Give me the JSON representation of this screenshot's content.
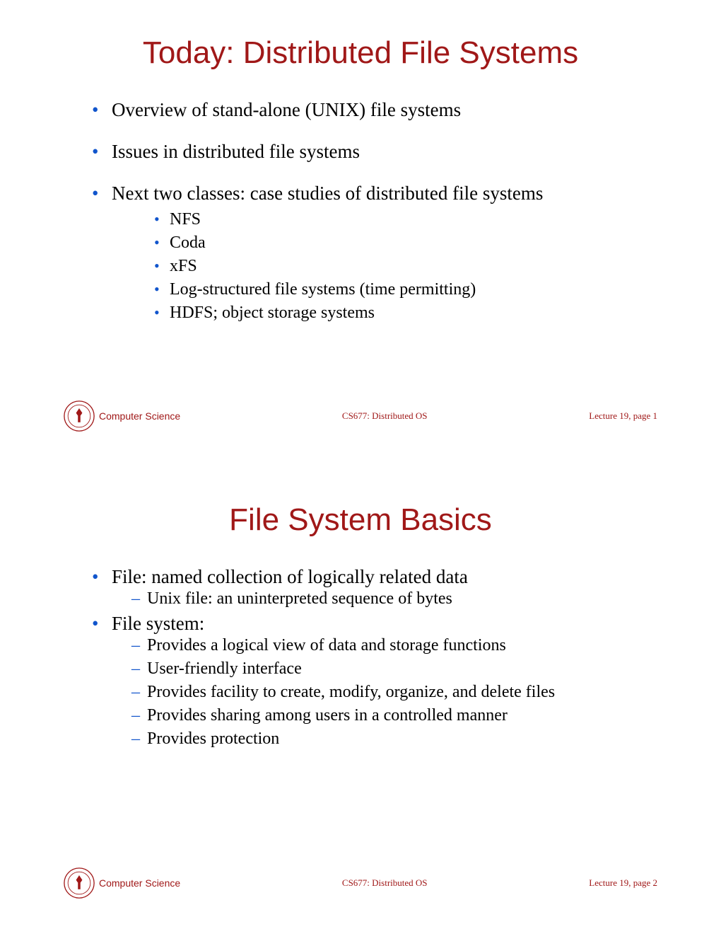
{
  "footer": {
    "dept": "Computer Science",
    "course": "CS677: Distributed OS",
    "lecture_prefix": "Lecture 19, page "
  },
  "slide1": {
    "title": "Today: Distributed File Systems",
    "page": "1",
    "b1": "Overview of stand-alone (UNIX) file systems",
    "b2": "Issues in distributed file systems",
    "b3": "Next two classes: case studies of distributed file systems",
    "sub": {
      "s1": "NFS",
      "s2": "Coda",
      "s3": "xFS",
      "s4": "Log-structured file systems (time permitting)",
      "s5": "HDFS; object storage systems"
    }
  },
  "slide2": {
    "title": "File System Basics",
    "page": "2",
    "b1": "File: named collection of logically related data",
    "b1_sub1": "Unix file: an uninterpreted sequence of bytes",
    "b2": "File system:",
    "b2_sub": {
      "s1": "Provides a logical view of data and storage functions",
      "s2": "User-friendly interface",
      "s3": "Provides facility to create, modify, organize, and delete files",
      "s4": "Provides sharing among users in a controlled manner",
      "s5": "Provides protection"
    }
  }
}
